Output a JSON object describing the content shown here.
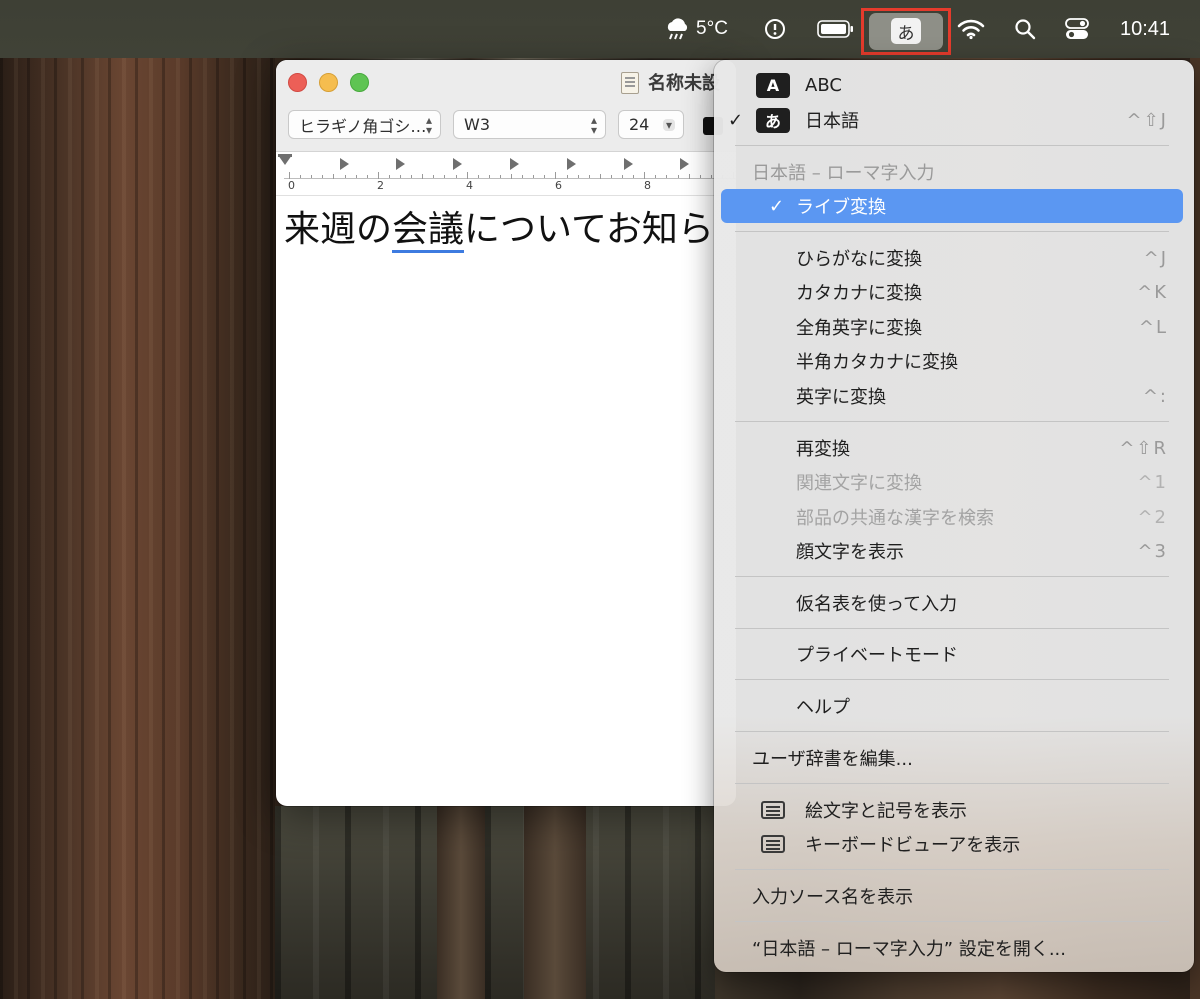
{
  "menubar": {
    "weather_temp": "5°C",
    "input_source_badge": "あ",
    "clock": "10:41"
  },
  "window": {
    "title": "名称未設",
    "font_family": "ヒラギノ角ゴシ…",
    "font_weight": "W3",
    "font_size": "24",
    "ruler_numbers": [
      "0",
      "2",
      "4",
      "6",
      "8"
    ],
    "document_text_plain": "来週の",
    "document_text_marked": "会議",
    "document_text_rest": "についてお知ら"
  },
  "menu": {
    "sources": [
      {
        "badge": "A",
        "label": "ABC",
        "checked": false,
        "shortcut": ""
      },
      {
        "badge": "あ",
        "label": "日本語",
        "checked": true,
        "shortcut": "^⇧J"
      }
    ],
    "section_header": "日本語 – ローマ字入力",
    "live_conversion": "ライブ変換",
    "convert_items": [
      {
        "label": "ひらがなに変換",
        "shortcut": "^J",
        "disabled": false
      },
      {
        "label": "カタカナに変換",
        "shortcut": "^K",
        "disabled": false
      },
      {
        "label": "全角英字に変換",
        "shortcut": "^L",
        "disabled": false
      },
      {
        "label": "半角カタカナに変換",
        "shortcut": "",
        "disabled": false
      },
      {
        "label": "英字に変換",
        "shortcut": "^:",
        "disabled": false
      }
    ],
    "reconvert_items": [
      {
        "label": "再変換",
        "shortcut": "^⇧R",
        "disabled": false
      },
      {
        "label": "関連文字に変換",
        "shortcut": "^1",
        "disabled": true
      },
      {
        "label": "部品の共通な漢字を検索",
        "shortcut": "^2",
        "disabled": true
      },
      {
        "label": "顔文字を表示",
        "shortcut": "^3",
        "disabled": false
      }
    ],
    "kana_table": "仮名表を使って入力",
    "private_mode": "プライベートモード",
    "help": "ヘルプ",
    "edit_dictionary": "ユーザ辞書を編集...",
    "show_emoji": "絵文字と記号を表示",
    "show_keyboard_viewer": "キーボードビューアを表示",
    "show_input_source_name": "入力ソース名を表示",
    "open_settings": "“日本語 – ローマ字入力” 設定を開く..."
  },
  "colors": {
    "menu_highlight": "#5b97f2",
    "annotation_red": "#e53b2c",
    "underline_blue": "#3d7be0"
  }
}
